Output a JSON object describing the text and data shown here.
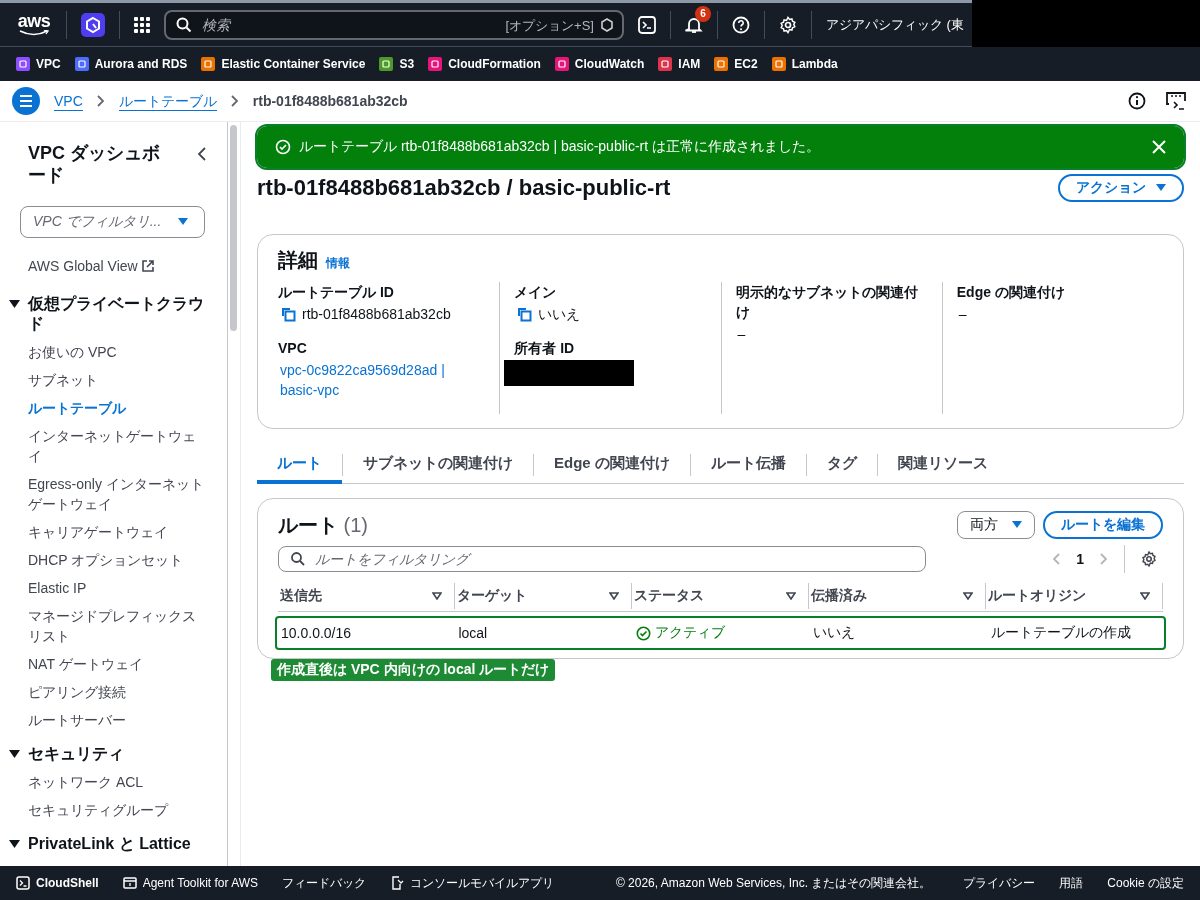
{
  "top_nav": {
    "logo": "aws",
    "search": {
      "placeholder": "検索",
      "shortcut": "[オプション+S]"
    },
    "notifications": {
      "count": "6"
    },
    "region": "アジアパシフィック (東"
  },
  "favorites": [
    {
      "label": "VPC",
      "color": "#8c4fff"
    },
    {
      "label": "Aurora and RDS",
      "color": "#4d6bfe"
    },
    {
      "label": "Elastic Container Service",
      "color": "#ed7100"
    },
    {
      "label": "S3",
      "color": "#4b9a2a"
    },
    {
      "label": "CloudFormation",
      "color": "#e7157b"
    },
    {
      "label": "CloudWatch",
      "color": "#e7157b"
    },
    {
      "label": "IAM",
      "color": "#dd344c"
    },
    {
      "label": "EC2",
      "color": "#ed7100"
    },
    {
      "label": "Lambda",
      "color": "#ed7100"
    }
  ],
  "breadcrumbs": [
    {
      "label": "VPC",
      "kind": "link"
    },
    {
      "label": "ルートテーブル",
      "kind": "link"
    },
    {
      "label": "rtb-01f8488b681ab32cb",
      "kind": "current"
    }
  ],
  "sidebar": {
    "title": "VPC ダッシュボード",
    "filter": {
      "placeholder": "VPC でフィルタリ..."
    },
    "items": [
      {
        "label": "AWS Global View",
        "kind": "external",
        "selected": false
      },
      {
        "label": "仮想プライベートクラウド",
        "kind": "section",
        "expanded": true,
        "children": [
          {
            "label": "お使いの VPC",
            "kind": "link",
            "selected": false
          },
          {
            "label": "サブネット",
            "kind": "link",
            "selected": false
          },
          {
            "label": "ルートテーブル",
            "kind": "link",
            "selected": true
          },
          {
            "label": "インターネットゲートウェイ",
            "kind": "link",
            "selected": false
          },
          {
            "label": "Egress-only インターネットゲートウェイ",
            "kind": "link",
            "selected": false
          },
          {
            "label": "キャリアゲートウェイ",
            "kind": "link",
            "selected": false
          },
          {
            "label": "DHCP オプションセット",
            "kind": "link",
            "selected": false
          },
          {
            "label": "Elastic IP",
            "kind": "link",
            "selected": false
          },
          {
            "label": "マネージドプレフィックスリスト",
            "kind": "link",
            "selected": false
          },
          {
            "label": "NAT ゲートウェイ",
            "kind": "link",
            "selected": false
          },
          {
            "label": "ピアリング接続",
            "kind": "link",
            "selected": false
          },
          {
            "label": "ルートサーバー",
            "kind": "link",
            "selected": false
          }
        ]
      },
      {
        "label": "セキュリティ",
        "kind": "section",
        "expanded": true,
        "children": [
          {
            "label": "ネットワーク ACL",
            "kind": "link",
            "selected": false
          },
          {
            "label": "セキュリティグループ",
            "kind": "link",
            "selected": false
          }
        ]
      },
      {
        "label": "PrivateLink と Lattice",
        "kind": "section",
        "expanded": true
      }
    ]
  },
  "flash": {
    "message": "ルートテーブル rtb-01f8488b681ab32cb | basic-public-rt は正常に作成されました。",
    "kind": "success"
  },
  "page": {
    "title": "rtb-01f8488b681ab32cb / basic-public-rt",
    "actions": "アクション"
  },
  "details": {
    "title": "詳細",
    "info": "情報",
    "columns": [
      [
        {
          "label": "ルートテーブル ID",
          "value": "rtb-01f8488b681ab32cb",
          "kind": "copy"
        },
        {
          "label": "VPC",
          "value": "vpc-0c9822ca9569d28ad | basic-vpc",
          "kind": "link"
        }
      ],
      [
        {
          "label": "メイン",
          "value": "いいえ",
          "kind": "copy"
        },
        {
          "label": "所有者 ID",
          "kind": "redacted"
        }
      ],
      [
        {
          "label": "明示的なサブネットの関連付け",
          "value": "–",
          "kind": "text"
        }
      ],
      [
        {
          "label": "Edge の関連付け",
          "value": "–",
          "kind": "text"
        }
      ]
    ]
  },
  "tabs": [
    {
      "label": "ルート",
      "selected": true
    },
    {
      "label": "サブネットの関連付け",
      "selected": false
    },
    {
      "label": "Edge の関連付け",
      "selected": false
    },
    {
      "label": "ルート伝播",
      "selected": false
    },
    {
      "label": "タグ",
      "selected": false
    },
    {
      "label": "関連リソース",
      "selected": false
    }
  ],
  "routes": {
    "title": "ルート",
    "count": "(1)",
    "filter_dropdown": "両方",
    "edit_button": "ルートを編集",
    "search": {
      "placeholder": "ルートをフィルタリング"
    },
    "page": "1",
    "columns": [
      "送信先",
      "ターゲット",
      "ステータス",
      "伝播済み",
      "ルートオリジン"
    ],
    "rows": [
      {
        "cells": [
          "10.0.0.0/16",
          "local",
          "アクティブ",
          "いいえ",
          "ルートテーブルの作成"
        ],
        "highlighted": true
      }
    ]
  },
  "annotation": "作成直後は VPC 内向けの local ルートだけ",
  "footer": {
    "items": [
      {
        "label": "CloudShell",
        "kind": "terminal"
      },
      {
        "label": "Agent Toolkit for AWS",
        "kind": "toolkit"
      },
      {
        "label": "フィードバック",
        "kind": "text"
      },
      {
        "label": "コンソールモバイルアプリ",
        "kind": "mobile"
      }
    ],
    "copyright": "© 2026, Amazon Web Services, Inc. またはその関連会社。",
    "links": [
      "プライバシー",
      "用語",
      "Cookie の設定"
    ]
  }
}
